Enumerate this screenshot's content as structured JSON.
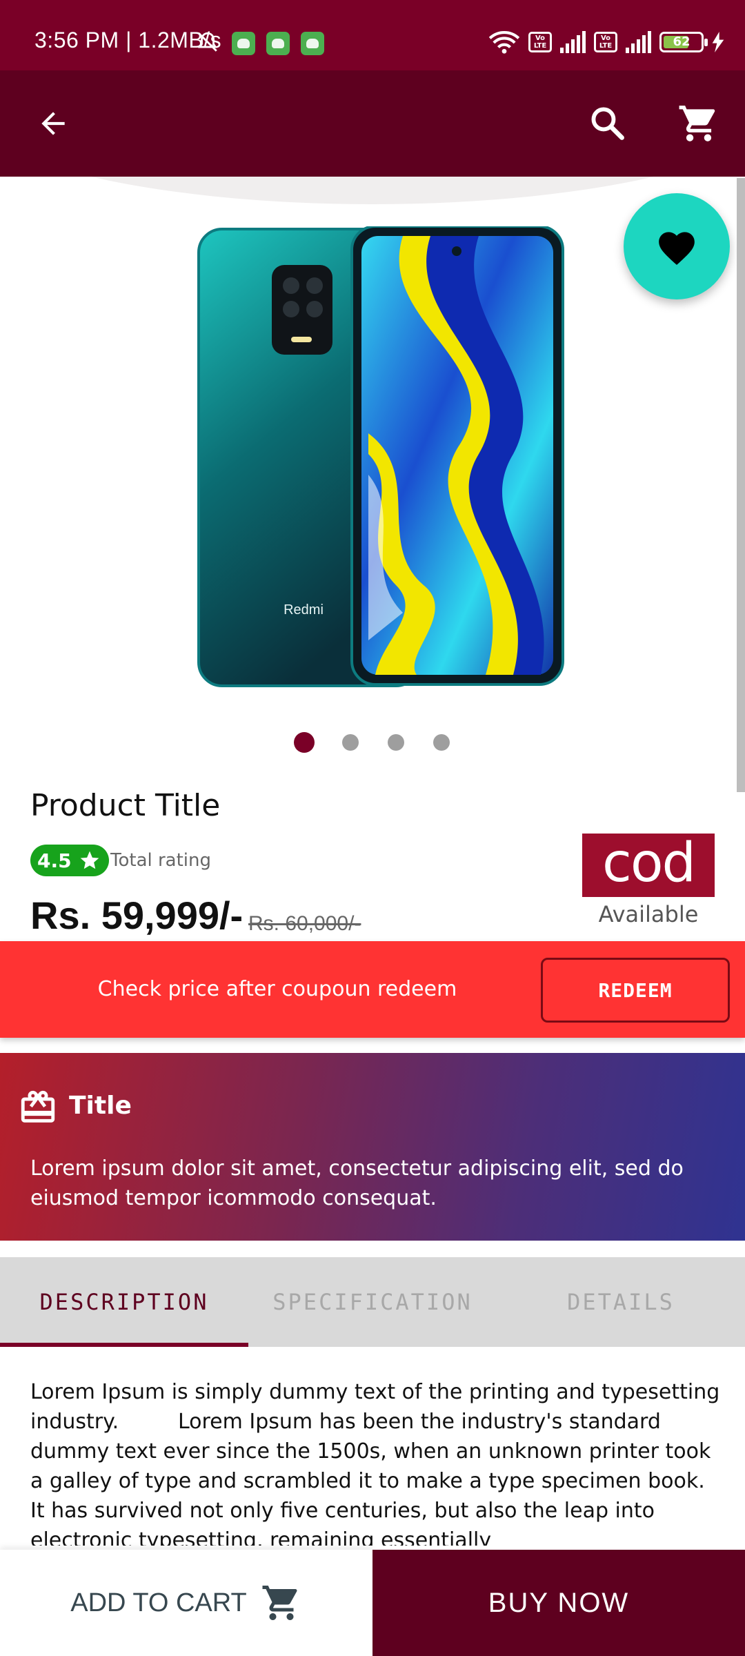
{
  "status_bar": {
    "time": "3:56 PM | 1.2MB/s",
    "battery": "62"
  },
  "product": {
    "title": "Product Title",
    "rating": "4.5",
    "rating_label": "Total rating",
    "price": "Rs. 59,999/-",
    "old_price": "Rs. 60,000/-",
    "cod_label": "cod",
    "cod_status": "Available",
    "image_brand": "Redmi",
    "carousel_pages": 4,
    "carousel_active": 1
  },
  "coupon": {
    "text": "Check price after coupoun redeem",
    "button": "REDEEM"
  },
  "promo": {
    "title": "Title",
    "body": "Lorem ipsum dolor sit amet, consectetur adipiscing elit, sed do eiusmod tempor icommodo consequat."
  },
  "tabs": [
    {
      "label": "DESCRIPTION"
    },
    {
      "label": "SPECIFICATION"
    },
    {
      "label": "DETAILS"
    }
  ],
  "description": "Lorem Ipsum is simply dummy text of the printing and typesetting industry.         Lorem Ipsum has been the industry's standard dummy text ever since the 1500s, when an unknown printer took a galley of type and scrambled it to make a type specimen book. It has survived not only five centuries, but also the leap into electronic typesetting, remaining essentially unchanged.         Lorem Ipsum is simplyandard",
  "bottom_bar": {
    "add_to_cart": "ADD TO CART",
    "buy_now": "BUY NOW"
  },
  "icons": {
    "back": "arrow-left-icon",
    "search": "search-icon",
    "cart": "cart-icon",
    "favorite": "heart-icon",
    "gift": "gift-card-icon"
  },
  "colors": {
    "primary": "#7a0027",
    "primary_dark": "#5e001f",
    "accent": "#1dd6c0",
    "coupon": "#ff3333",
    "rating": "#17a31c",
    "cod": "#9d0e2d"
  }
}
